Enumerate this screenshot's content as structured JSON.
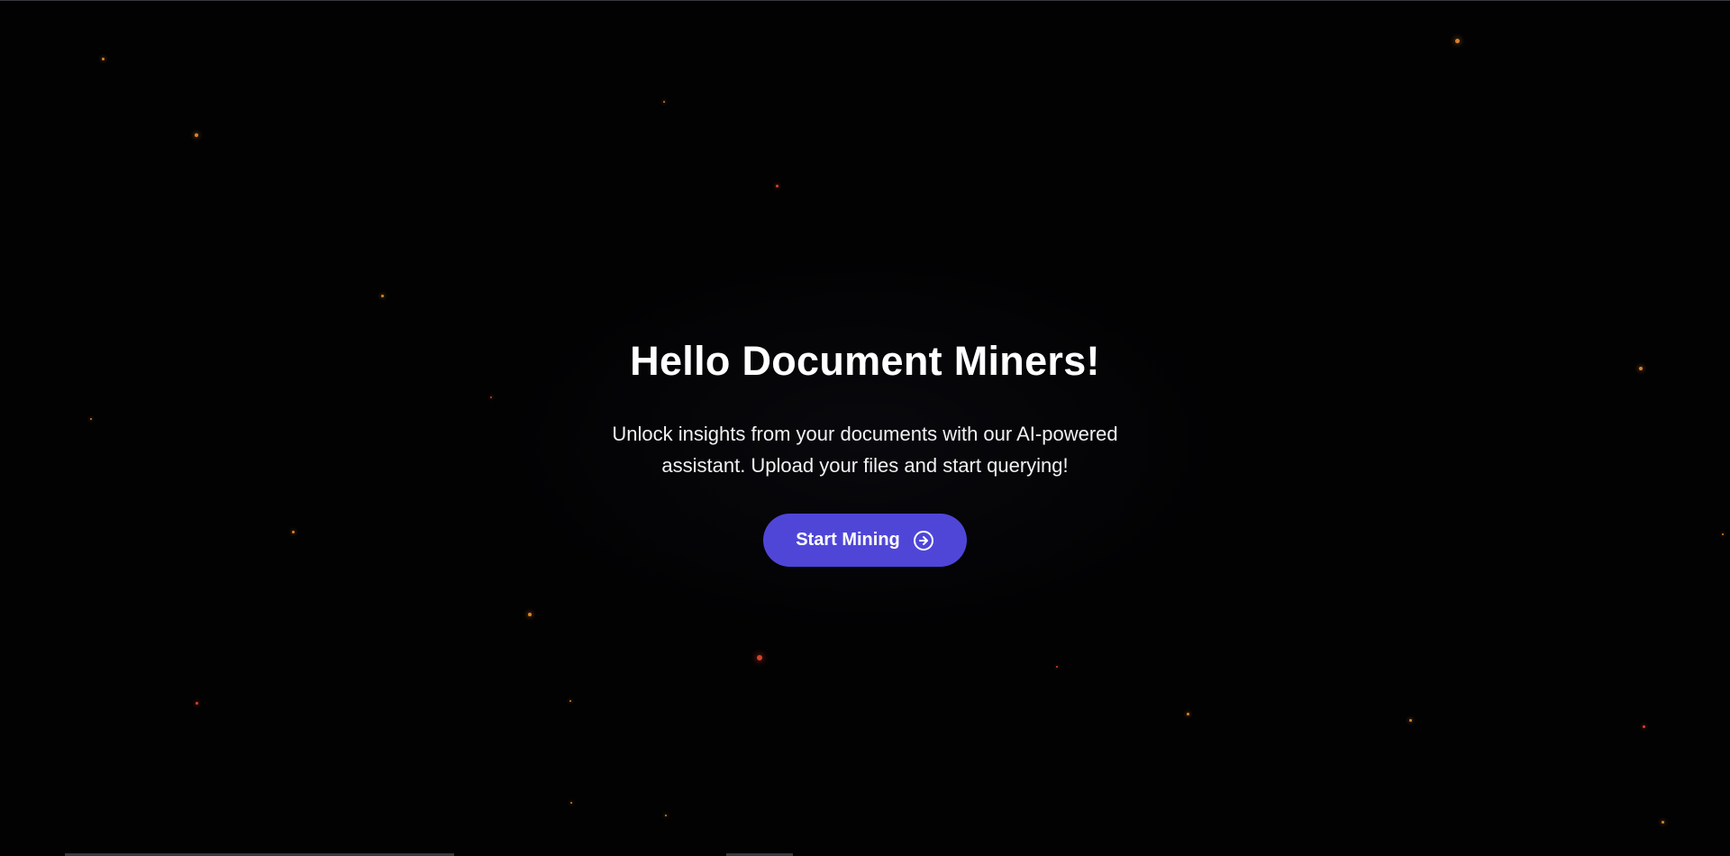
{
  "hero": {
    "title": "Hello Document Miners!",
    "subtitle": "Unlock insights from your documents with our AI-powered assistant. Upload your files and start querying!",
    "cta_label": "Start Mining",
    "cta_icon": "arrow-right-circle-icon"
  },
  "colors": {
    "background": "#020203",
    "accent": "#4f46d8",
    "star_orange": "#d9822b",
    "star_red": "#d6402a"
  }
}
